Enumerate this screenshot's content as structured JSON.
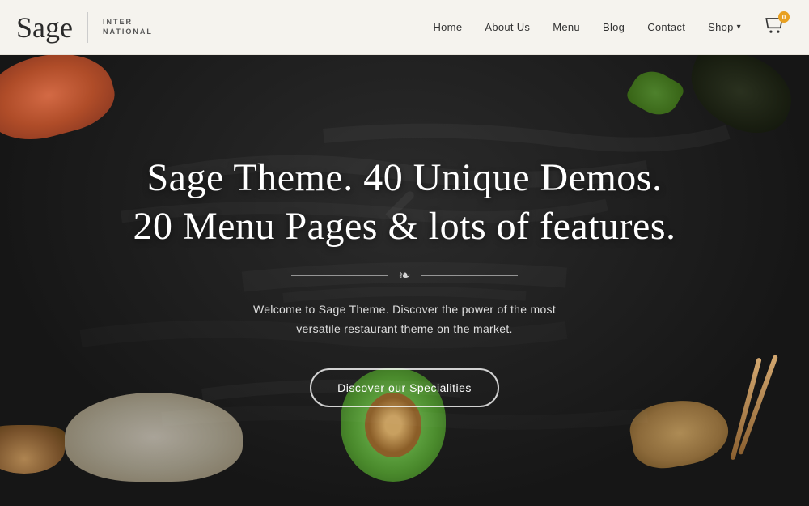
{
  "header": {
    "logo_text": "Sage",
    "logo_sub_line1": "INTER",
    "logo_sub_line2": "NATIONAL",
    "nav": {
      "home": "Home",
      "about": "About Us",
      "menu": "Menu",
      "blog": "Blog",
      "contact": "Contact",
      "shop": "Shop",
      "cart_count": "0"
    }
  },
  "hero": {
    "title_line1": "Sage Theme. 40 Unique Demos.",
    "title_line2": "20 Menu Pages & lots of features.",
    "subtitle_line1": "Welcome to Sage Theme. Discover the power of the most",
    "subtitle_line2": "versatile restaurant theme on the market.",
    "cta_button": "Discover our Specialities",
    "divider_icon": "❧"
  }
}
